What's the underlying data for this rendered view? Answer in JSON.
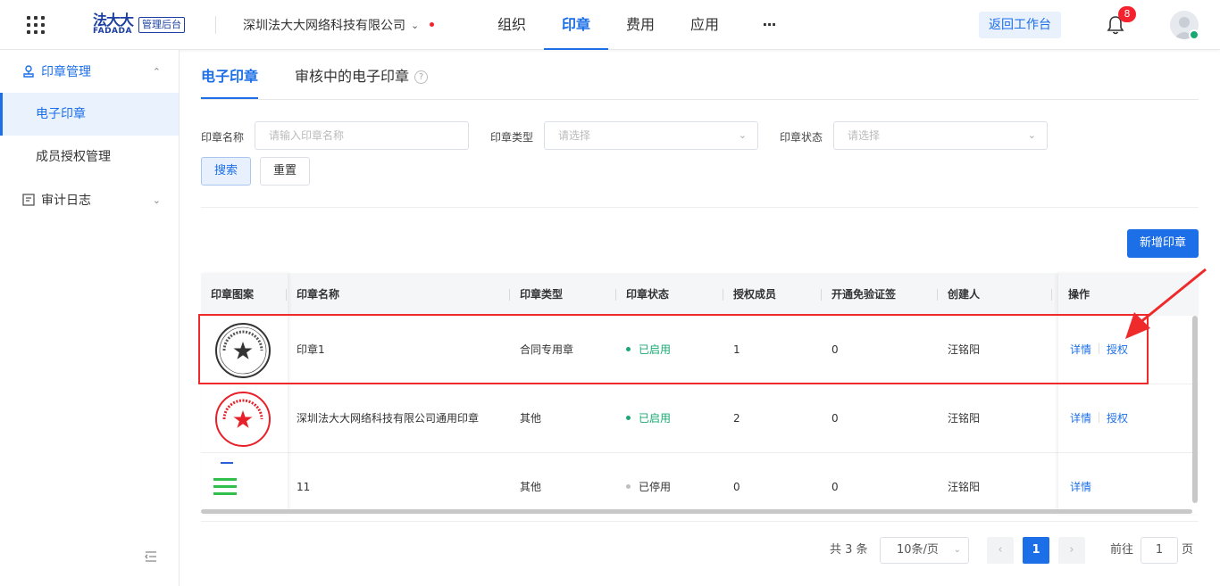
{
  "header": {
    "logo_cn": "法大大",
    "logo_en": "FADADA",
    "logo_badge": "管理后台",
    "company": "深圳法大大网络科技有限公司",
    "nav": [
      "组织",
      "印章",
      "费用",
      "应用"
    ],
    "nav_more": "···",
    "active_nav": "印章",
    "return_label": "返回工作台",
    "notification_count": "8"
  },
  "sidebar": {
    "groups": [
      {
        "label": "印章管理",
        "icon": "seal-icon",
        "expanded": true
      },
      {
        "label": "审计日志",
        "icon": "log-icon",
        "expanded": false
      }
    ],
    "items": [
      {
        "label": "电子印章",
        "active": true
      },
      {
        "label": "成员授权管理",
        "active": false
      }
    ]
  },
  "tabs": [
    {
      "label": "电子印章",
      "active": true
    },
    {
      "label": "审核中的电子印章",
      "active": false
    }
  ],
  "filters": {
    "name_label": "印章名称",
    "name_placeholder": "请输入印章名称",
    "type_label": "印章类型",
    "type_placeholder": "请选择",
    "status_label": "印章状态",
    "status_placeholder": "请选择",
    "search_label": "搜索",
    "reset_label": "重置"
  },
  "add_button": "新增印章",
  "table": {
    "columns": [
      "印章图案",
      "印章名称",
      "印章类型",
      "印章状态",
      "授权成员",
      "开通免验证签",
      "创建人",
      "操作"
    ],
    "rows": [
      {
        "name": "印章1",
        "type": "合同专用章",
        "status": "已启用",
        "status_on": true,
        "members": "1",
        "exempt": "0",
        "creator": "汪铭阳",
        "actions": [
          "详情",
          "授权"
        ],
        "seal_color": "#333333",
        "seal_text": "深圳法大大网络科技有限公司"
      },
      {
        "name": "深圳法大大网络科技有限公司通用印章",
        "type": "其他",
        "status": "已启用",
        "status_on": true,
        "members": "2",
        "exempt": "0",
        "creator": "汪铭阳",
        "actions": [
          "详情",
          "授权"
        ],
        "seal_color": "#e8202a",
        "seal_text": "深圳法大大网络科技有限公司"
      },
      {
        "name": "11",
        "type": "其他",
        "status": "已停用",
        "status_on": false,
        "members": "0",
        "exempt": "0",
        "creator": "汪铭阳",
        "actions": [
          "详情"
        ],
        "seal_color": "#2fbf4a",
        "seal_text": ""
      }
    ]
  },
  "pagination": {
    "total": "共 3 条",
    "page_size": "10条/页",
    "current": "1",
    "goto_label": "前往",
    "goto_value": "1",
    "page_unit": "页"
  },
  "colors": {
    "primary": "#1c6fe7",
    "success": "#19a873",
    "danger": "#f5222d",
    "annotation": "#ee2a2a"
  }
}
